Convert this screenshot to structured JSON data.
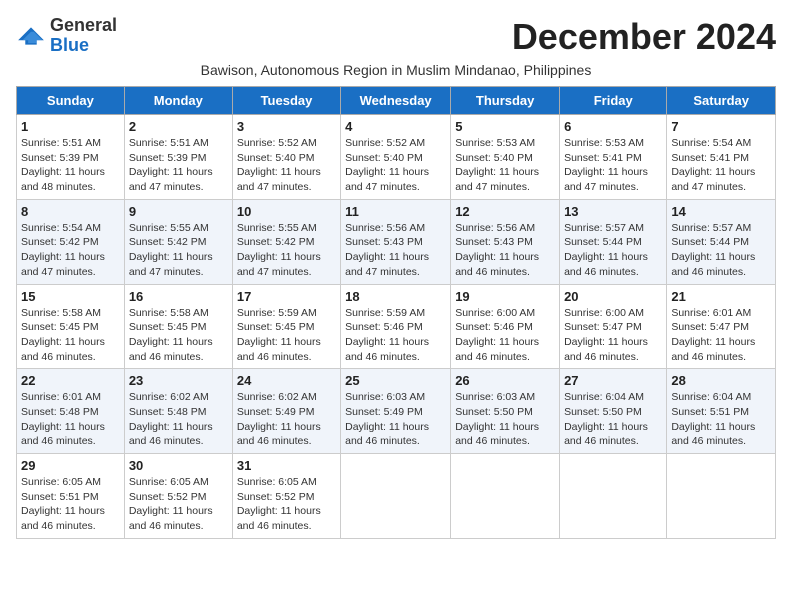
{
  "header": {
    "logo_general": "General",
    "logo_blue": "Blue",
    "month_title": "December 2024",
    "subtitle": "Bawison, Autonomous Region in Muslim Mindanao, Philippines"
  },
  "days_of_week": [
    "Sunday",
    "Monday",
    "Tuesday",
    "Wednesday",
    "Thursday",
    "Friday",
    "Saturday"
  ],
  "weeks": [
    [
      {
        "day": "1",
        "info": "Sunrise: 5:51 AM\nSunset: 5:39 PM\nDaylight: 11 hours\nand 48 minutes."
      },
      {
        "day": "2",
        "info": "Sunrise: 5:51 AM\nSunset: 5:39 PM\nDaylight: 11 hours\nand 47 minutes."
      },
      {
        "day": "3",
        "info": "Sunrise: 5:52 AM\nSunset: 5:40 PM\nDaylight: 11 hours\nand 47 minutes."
      },
      {
        "day": "4",
        "info": "Sunrise: 5:52 AM\nSunset: 5:40 PM\nDaylight: 11 hours\nand 47 minutes."
      },
      {
        "day": "5",
        "info": "Sunrise: 5:53 AM\nSunset: 5:40 PM\nDaylight: 11 hours\nand 47 minutes."
      },
      {
        "day": "6",
        "info": "Sunrise: 5:53 AM\nSunset: 5:41 PM\nDaylight: 11 hours\nand 47 minutes."
      },
      {
        "day": "7",
        "info": "Sunrise: 5:54 AM\nSunset: 5:41 PM\nDaylight: 11 hours\nand 47 minutes."
      }
    ],
    [
      {
        "day": "8",
        "info": "Sunrise: 5:54 AM\nSunset: 5:42 PM\nDaylight: 11 hours\nand 47 minutes."
      },
      {
        "day": "9",
        "info": "Sunrise: 5:55 AM\nSunset: 5:42 PM\nDaylight: 11 hours\nand 47 minutes."
      },
      {
        "day": "10",
        "info": "Sunrise: 5:55 AM\nSunset: 5:42 PM\nDaylight: 11 hours\nand 47 minutes."
      },
      {
        "day": "11",
        "info": "Sunrise: 5:56 AM\nSunset: 5:43 PM\nDaylight: 11 hours\nand 47 minutes."
      },
      {
        "day": "12",
        "info": "Sunrise: 5:56 AM\nSunset: 5:43 PM\nDaylight: 11 hours\nand 46 minutes."
      },
      {
        "day": "13",
        "info": "Sunrise: 5:57 AM\nSunset: 5:44 PM\nDaylight: 11 hours\nand 46 minutes."
      },
      {
        "day": "14",
        "info": "Sunrise: 5:57 AM\nSunset: 5:44 PM\nDaylight: 11 hours\nand 46 minutes."
      }
    ],
    [
      {
        "day": "15",
        "info": "Sunrise: 5:58 AM\nSunset: 5:45 PM\nDaylight: 11 hours\nand 46 minutes."
      },
      {
        "day": "16",
        "info": "Sunrise: 5:58 AM\nSunset: 5:45 PM\nDaylight: 11 hours\nand 46 minutes."
      },
      {
        "day": "17",
        "info": "Sunrise: 5:59 AM\nSunset: 5:45 PM\nDaylight: 11 hours\nand 46 minutes."
      },
      {
        "day": "18",
        "info": "Sunrise: 5:59 AM\nSunset: 5:46 PM\nDaylight: 11 hours\nand 46 minutes."
      },
      {
        "day": "19",
        "info": "Sunrise: 6:00 AM\nSunset: 5:46 PM\nDaylight: 11 hours\nand 46 minutes."
      },
      {
        "day": "20",
        "info": "Sunrise: 6:00 AM\nSunset: 5:47 PM\nDaylight: 11 hours\nand 46 minutes."
      },
      {
        "day": "21",
        "info": "Sunrise: 6:01 AM\nSunset: 5:47 PM\nDaylight: 11 hours\nand 46 minutes."
      }
    ],
    [
      {
        "day": "22",
        "info": "Sunrise: 6:01 AM\nSunset: 5:48 PM\nDaylight: 11 hours\nand 46 minutes."
      },
      {
        "day": "23",
        "info": "Sunrise: 6:02 AM\nSunset: 5:48 PM\nDaylight: 11 hours\nand 46 minutes."
      },
      {
        "day": "24",
        "info": "Sunrise: 6:02 AM\nSunset: 5:49 PM\nDaylight: 11 hours\nand 46 minutes."
      },
      {
        "day": "25",
        "info": "Sunrise: 6:03 AM\nSunset: 5:49 PM\nDaylight: 11 hours\nand 46 minutes."
      },
      {
        "day": "26",
        "info": "Sunrise: 6:03 AM\nSunset: 5:50 PM\nDaylight: 11 hours\nand 46 minutes."
      },
      {
        "day": "27",
        "info": "Sunrise: 6:04 AM\nSunset: 5:50 PM\nDaylight: 11 hours\nand 46 minutes."
      },
      {
        "day": "28",
        "info": "Sunrise: 6:04 AM\nSunset: 5:51 PM\nDaylight: 11 hours\nand 46 minutes."
      }
    ],
    [
      {
        "day": "29",
        "info": "Sunrise: 6:05 AM\nSunset: 5:51 PM\nDaylight: 11 hours\nand 46 minutes."
      },
      {
        "day": "30",
        "info": "Sunrise: 6:05 AM\nSunset: 5:52 PM\nDaylight: 11 hours\nand 46 minutes."
      },
      {
        "day": "31",
        "info": "Sunrise: 6:05 AM\nSunset: 5:52 PM\nDaylight: 11 hours\nand 46 minutes."
      },
      null,
      null,
      null,
      null
    ]
  ]
}
